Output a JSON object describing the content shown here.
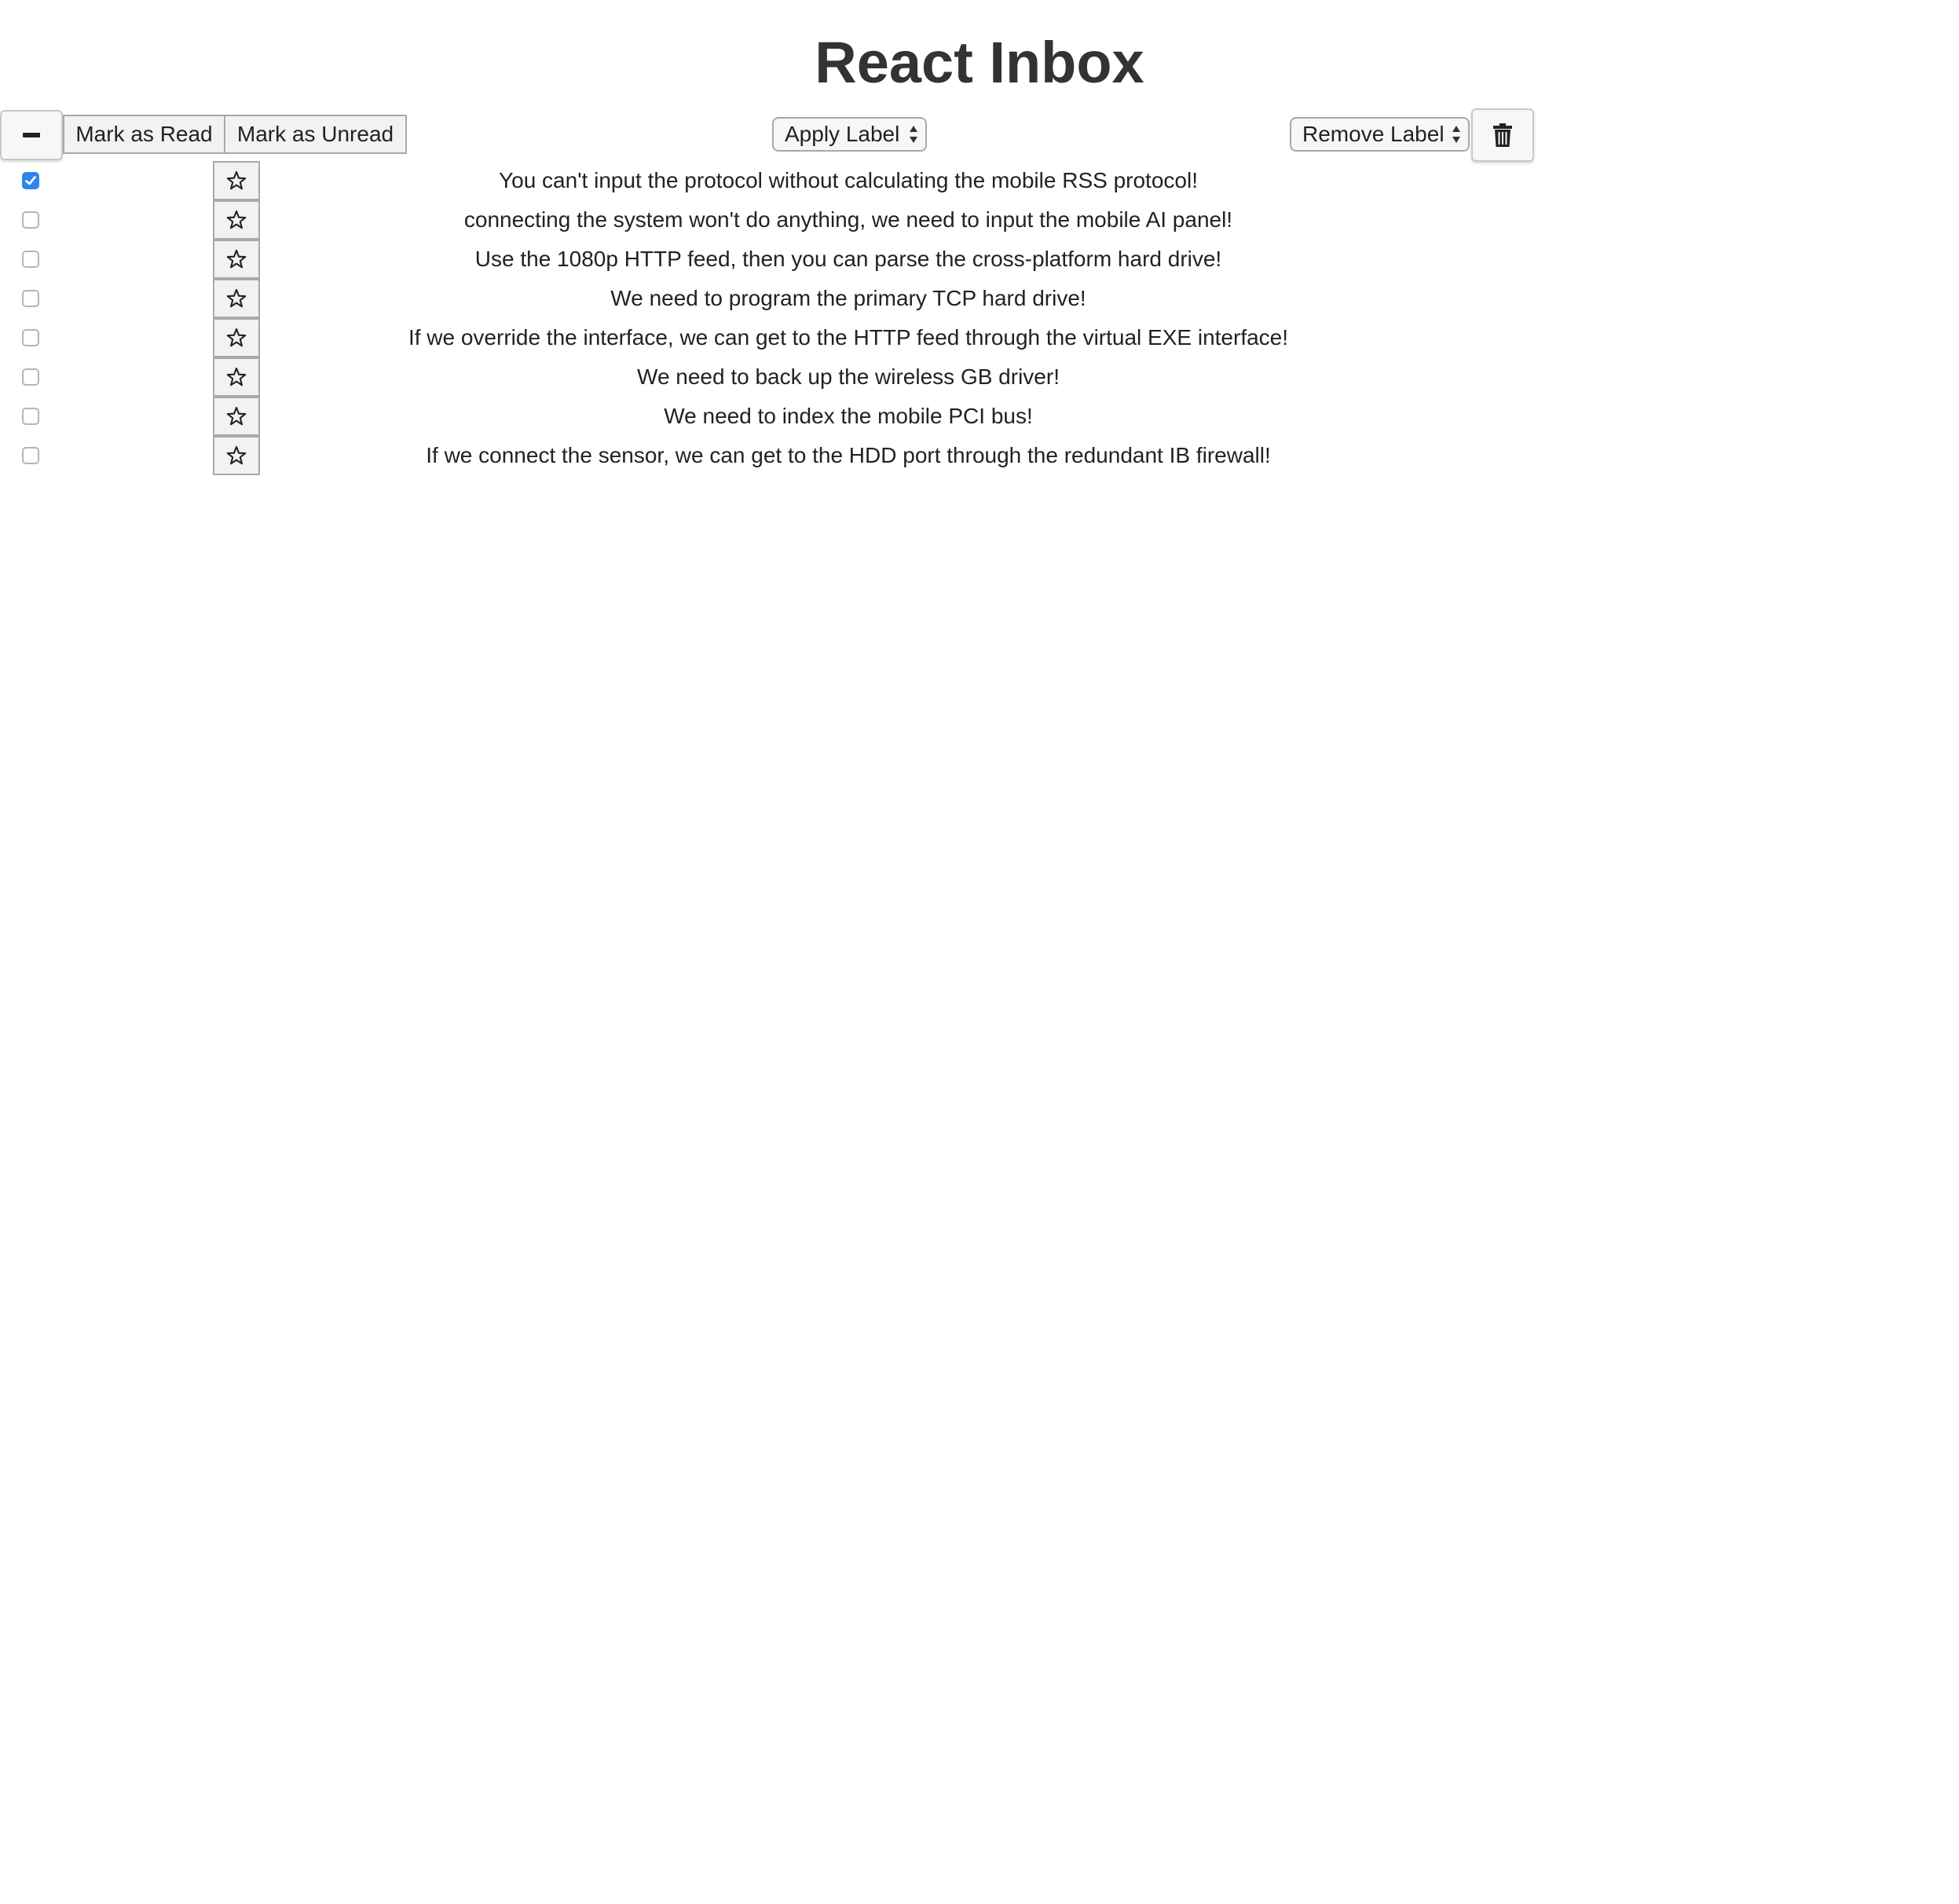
{
  "page": {
    "title": "React Inbox"
  },
  "toolbar": {
    "select_all_icon": "minus-icon",
    "mark_read_label": "Mark as Read",
    "mark_unread_label": "Mark as Unread",
    "apply_label_select": "Apply Label",
    "remove_label_select": "Remove Label",
    "delete_icon": "trash-icon"
  },
  "messages": [
    {
      "selected": true,
      "starred": false,
      "subject": "You can't input the protocol without calculating the mobile RSS protocol!"
    },
    {
      "selected": false,
      "starred": false,
      "subject": "connecting the system won't do anything, we need to input the mobile AI panel!"
    },
    {
      "selected": false,
      "starred": false,
      "subject": "Use the 1080p HTTP feed, then you can parse the cross-platform hard drive!"
    },
    {
      "selected": false,
      "starred": false,
      "subject": "We need to program the primary TCP hard drive!"
    },
    {
      "selected": false,
      "starred": false,
      "subject": "If we override the interface, we can get to the HTTP feed through the virtual EXE interface!"
    },
    {
      "selected": false,
      "starred": false,
      "subject": "We need to back up the wireless GB driver!"
    },
    {
      "selected": false,
      "starred": false,
      "subject": "We need to index the mobile PCI bus!"
    },
    {
      "selected": false,
      "starred": false,
      "subject": "If we connect the sensor, we can get to the HDD port through the redundant IB firewall!"
    }
  ],
  "colors": {
    "checkbox_checked": "#2f86e8",
    "button_background": "#f2f2f2",
    "text": "#222222"
  }
}
